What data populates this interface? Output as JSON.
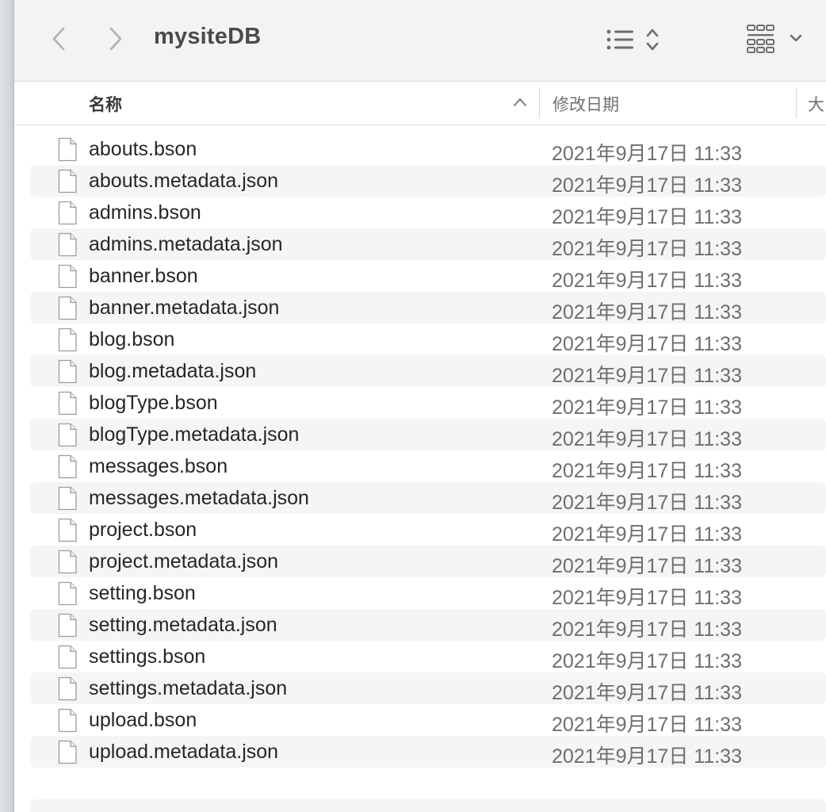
{
  "window": {
    "title": "mysiteDB"
  },
  "toolbar": {
    "back_icon": "chevron-left-icon",
    "forward_icon": "chevron-right-icon",
    "list_view_icon": "list-view-icon",
    "group_icon": "grid-group-icon"
  },
  "columns": {
    "name": "名称",
    "date_modified": "修改日期",
    "size": "大",
    "sort_indicator": "chevron-up-icon"
  },
  "files": [
    {
      "name": "abouts.bson",
      "date": "2021年9月17日 11:33"
    },
    {
      "name": "abouts.metadata.json",
      "date": "2021年9月17日 11:33"
    },
    {
      "name": "admins.bson",
      "date": "2021年9月17日 11:33"
    },
    {
      "name": "admins.metadata.json",
      "date": "2021年9月17日 11:33"
    },
    {
      "name": "banner.bson",
      "date": "2021年9月17日 11:33"
    },
    {
      "name": "banner.metadata.json",
      "date": "2021年9月17日 11:33"
    },
    {
      "name": "blog.bson",
      "date": "2021年9月17日 11:33"
    },
    {
      "name": "blog.metadata.json",
      "date": "2021年9月17日 11:33"
    },
    {
      "name": "blogType.bson",
      "date": "2021年9月17日 11:33"
    },
    {
      "name": "blogType.metadata.json",
      "date": "2021年9月17日 11:33"
    },
    {
      "name": "messages.bson",
      "date": "2021年9月17日 11:33"
    },
    {
      "name": "messages.metadata.json",
      "date": "2021年9月17日 11:33"
    },
    {
      "name": "project.bson",
      "date": "2021年9月17日 11:33"
    },
    {
      "name": "project.metadata.json",
      "date": "2021年9月17日 11:33"
    },
    {
      "name": "setting.bson",
      "date": "2021年9月17日 11:33"
    },
    {
      "name": "setting.metadata.json",
      "date": "2021年9月17日 11:33"
    },
    {
      "name": "settings.bson",
      "date": "2021年9月17日 11:33"
    },
    {
      "name": "settings.metadata.json",
      "date": "2021年9月17日 11:33"
    },
    {
      "name": "upload.bson",
      "date": "2021年9月17日 11:33"
    },
    {
      "name": "upload.metadata.json",
      "date": "2021年9月17日 11:33"
    }
  ],
  "colors": {
    "toolbar_bg": "#f3f3f3",
    "alt_row_bg": "#f4f5f5",
    "icon_gray": "#7a7a7a"
  }
}
